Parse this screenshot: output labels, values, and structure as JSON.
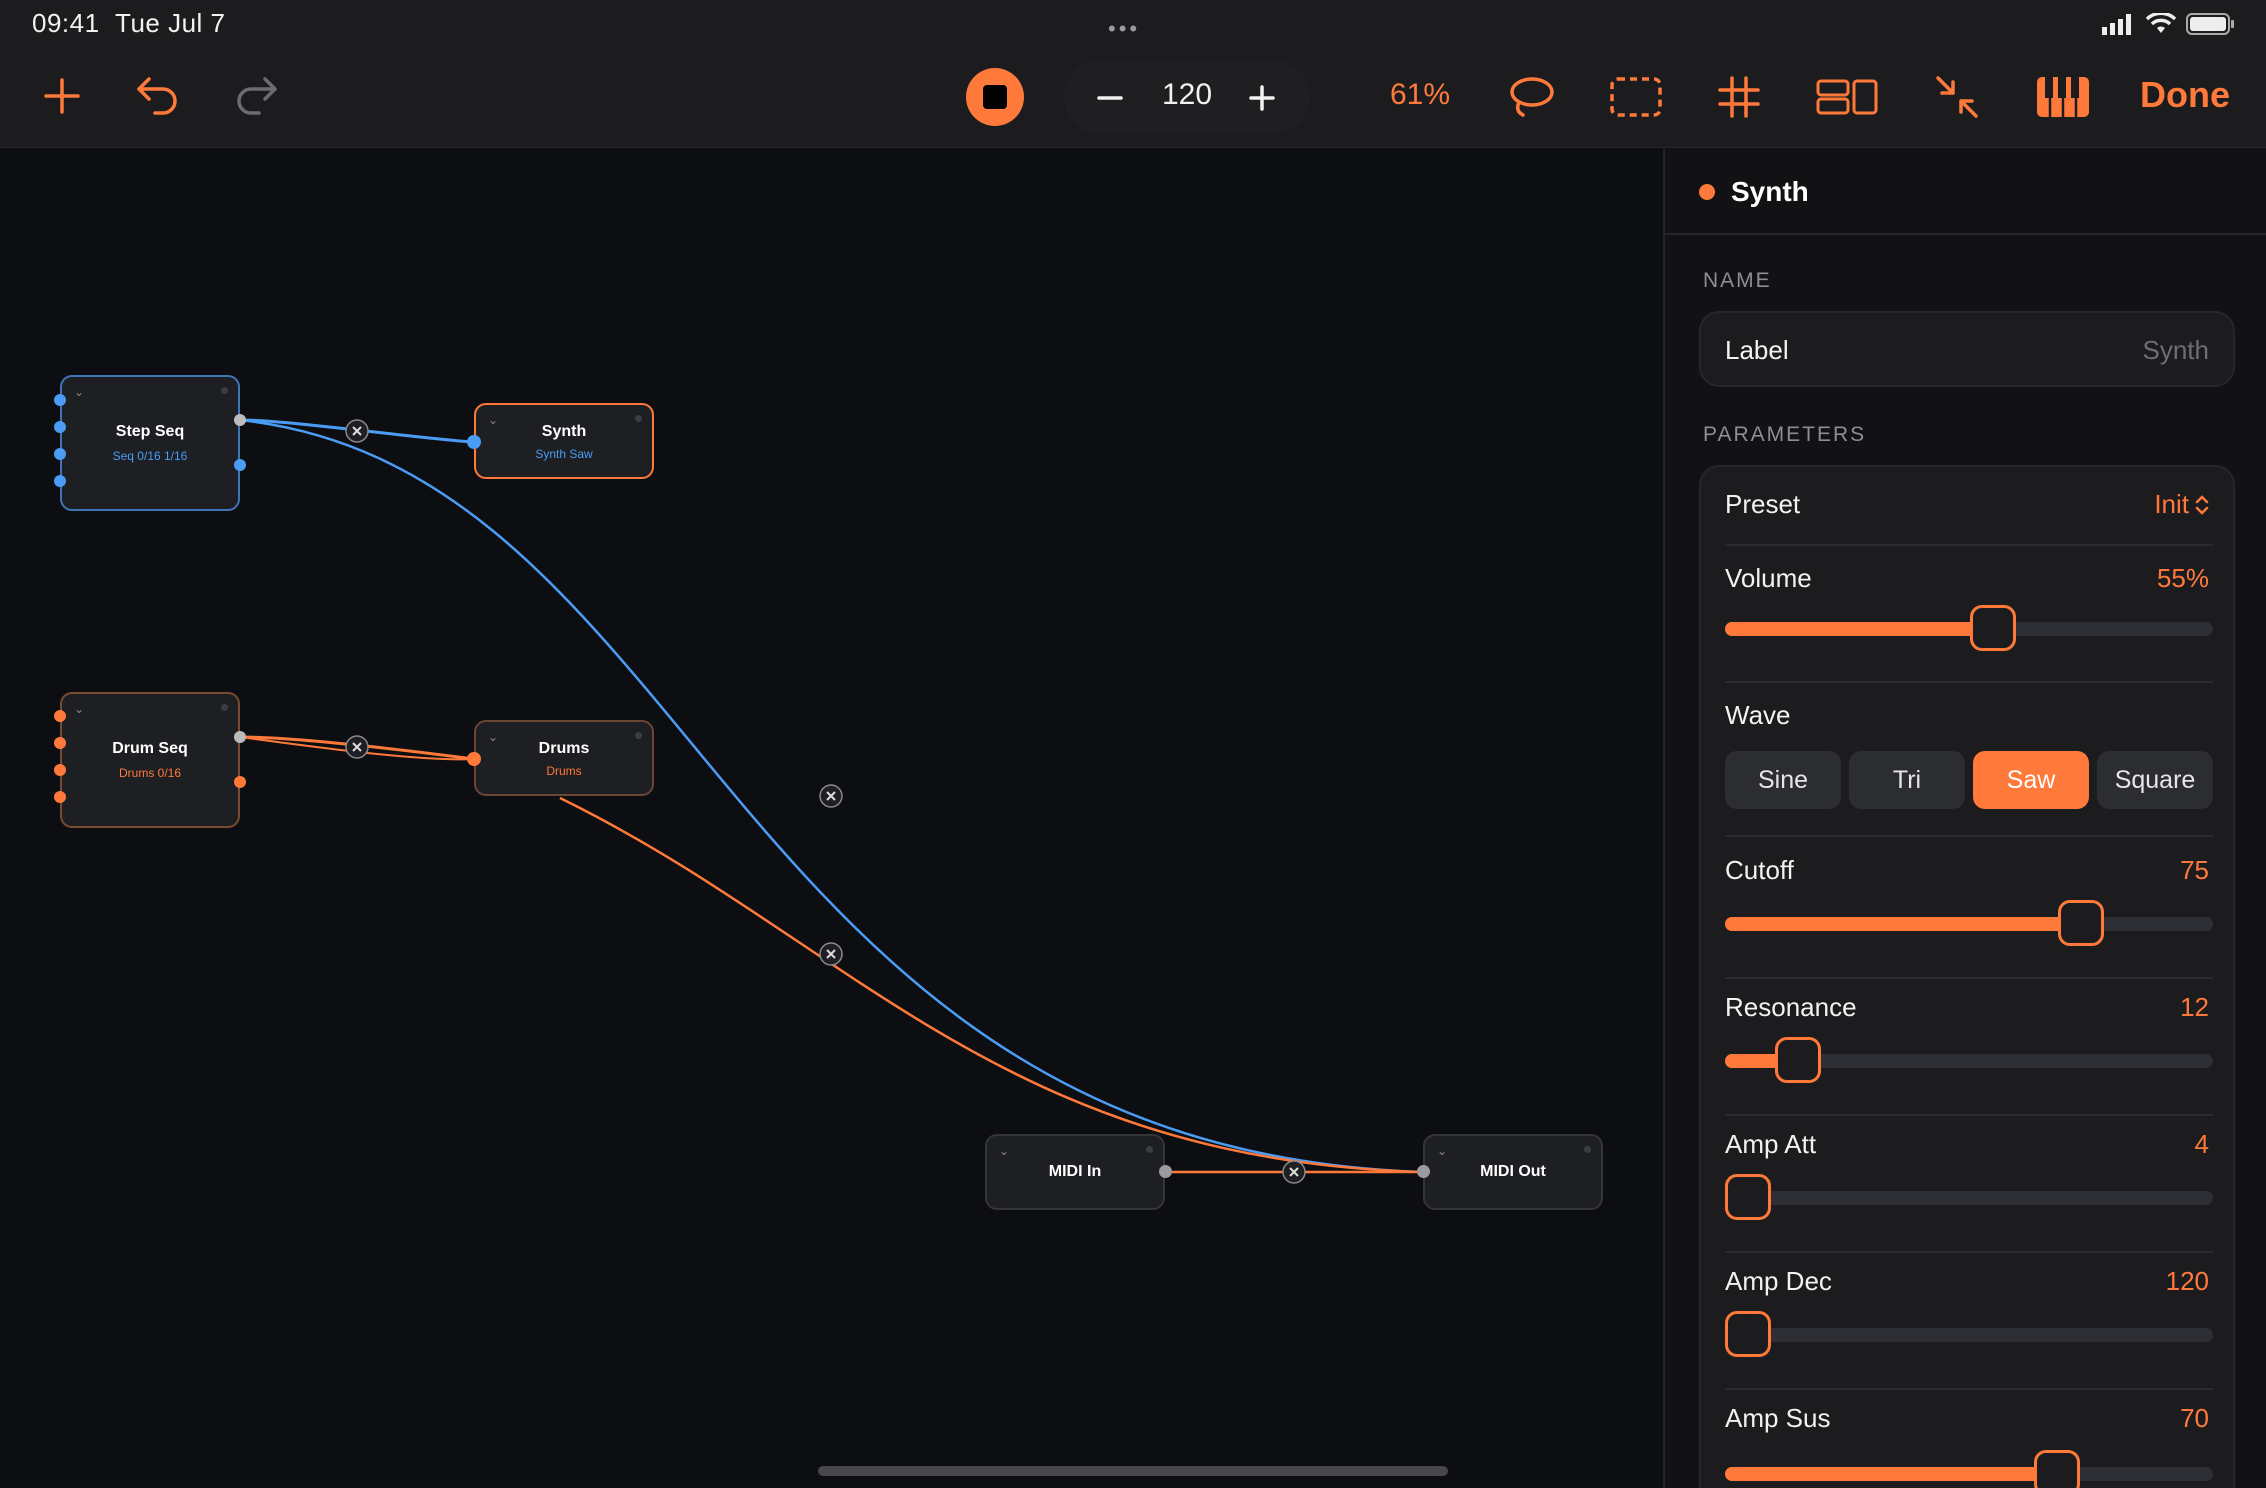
{
  "status": {
    "time": "09:41",
    "date": "Tue Jul 7",
    "dots": "•••"
  },
  "toolbar": {
    "tempo": "120",
    "zoom": "61%",
    "done_label": "Done",
    "accent": "#ff7a3a"
  },
  "nodes": {
    "step_seq": {
      "title": "Step Seq",
      "subtitle": "Seq 0/16 1/16"
    },
    "synth": {
      "title": "Synth",
      "subtitle": "Synth Saw"
    },
    "drum_seq": {
      "title": "Drum Seq",
      "subtitle": "Drums 0/16"
    },
    "drums": {
      "title": "Drums",
      "subtitle": "Drums"
    },
    "midi_in": {
      "title": "MIDI In"
    },
    "midi_out": {
      "title": "MIDI Out"
    }
  },
  "panel": {
    "title": "Synth",
    "name_section": "NAME",
    "label_key": "Label",
    "label_value": "Synth",
    "params_section": "PARAMETERS",
    "preset_label": "Preset",
    "preset_value": "Init",
    "volume": {
      "label": "Volume",
      "value": "55%",
      "level": 0.55
    },
    "wave": {
      "label": "Wave",
      "options": [
        "Sine",
        "Tri",
        "Saw",
        "Square"
      ],
      "selected": "Saw"
    },
    "cutoff": {
      "label": "Cutoff",
      "value": "75",
      "level": 0.73
    },
    "resonance": {
      "label": "Resonance",
      "value": "12",
      "level": 0.15
    },
    "amp_att": {
      "label": "Amp Att",
      "value": "4",
      "level": 0.0
    },
    "amp_dec": {
      "label": "Amp Dec",
      "value": "120",
      "level": 0.02
    },
    "amp_sus": {
      "label": "Amp Sus",
      "value": "70",
      "level": 0.68
    }
  }
}
